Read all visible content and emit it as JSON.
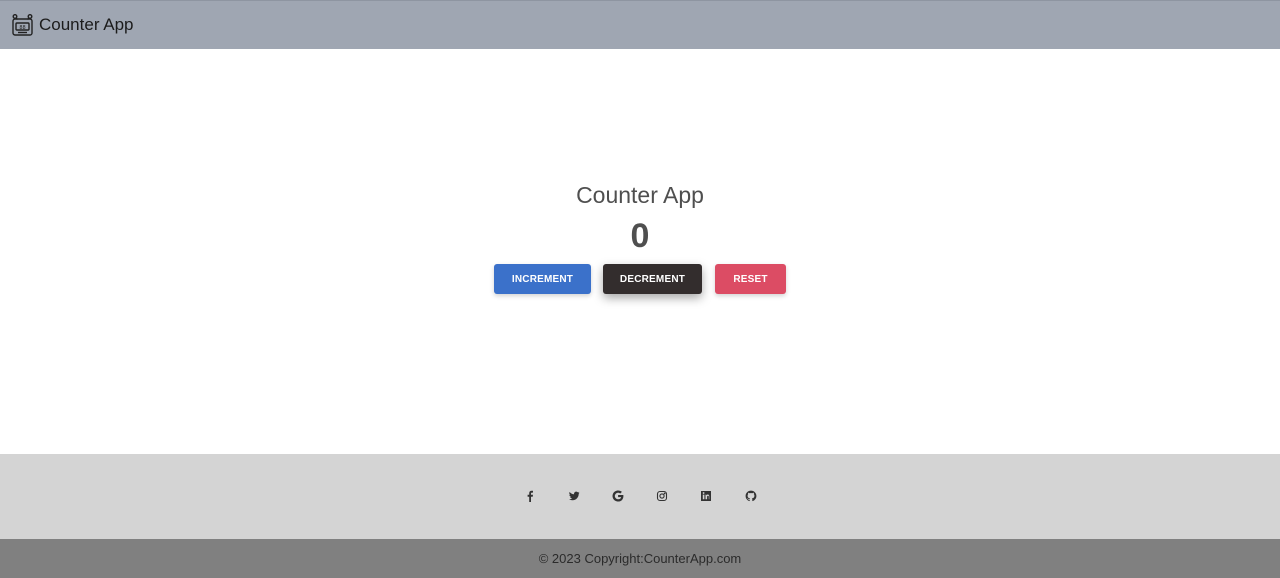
{
  "navbar": {
    "brand_icon": "counter-device-icon",
    "brand_text": "Counter App"
  },
  "main": {
    "title": "Counter App",
    "count": "0",
    "buttons": {
      "increment": "INCREMENT",
      "decrement": "DECREMENT",
      "reset": "RESET"
    }
  },
  "footer": {
    "social_icons": [
      "facebook-icon",
      "twitter-icon",
      "google-icon",
      "instagram-icon",
      "linkedin-icon",
      "github-icon"
    ],
    "copyright": "© 2023 Copyright:CounterApp.com"
  },
  "colors": {
    "navbar_bg": "#9fa6b2",
    "increment": "#3b71ca",
    "decrement": "#332d2d",
    "reset": "#dc4c64",
    "social_bg": "#d4d4d4",
    "footer_bg": "#808080"
  }
}
